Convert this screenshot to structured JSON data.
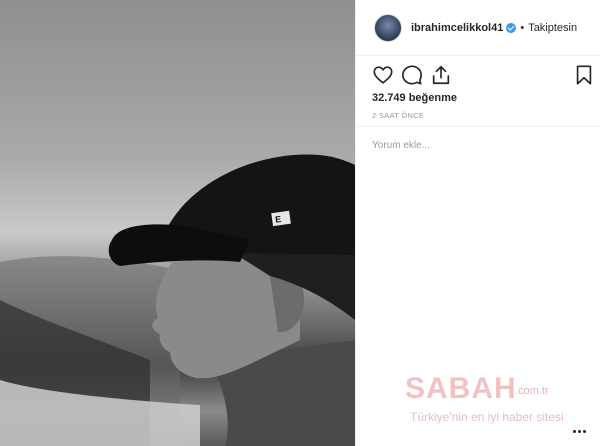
{
  "post": {
    "username": "ibrahimcelikkol41",
    "verified": true,
    "separator": "•",
    "follow_status": "Takiptesin",
    "likes": "32.749 beğenme",
    "time_ago": "2 SAAT ÖNCE",
    "comment_placeholder": "Yorum ekle..."
  },
  "icons": {
    "like": "heart-icon",
    "comment": "comment-icon",
    "share": "share-icon",
    "save": "bookmark-icon",
    "more": "more-options-icon"
  },
  "watermark": {
    "logo": "SABAH",
    "domain": ".com.tr",
    "tagline": "Türkiye'nin en iyi haber sitesi"
  },
  "colors": {
    "verified_badge": "#3897f0",
    "watermark": "#d9534f"
  }
}
